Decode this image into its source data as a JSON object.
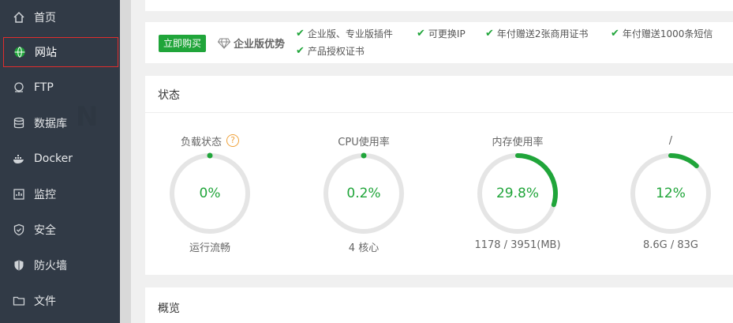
{
  "sidebar": {
    "items": [
      {
        "label": "首页",
        "icon": "home-icon"
      },
      {
        "label": "网站",
        "icon": "globe-icon",
        "active": true
      },
      {
        "label": "FTP",
        "icon": "ftp-icon"
      },
      {
        "label": "数据库",
        "icon": "database-icon"
      },
      {
        "label": "Docker",
        "icon": "docker-icon"
      },
      {
        "label": "监控",
        "icon": "monitor-icon"
      },
      {
        "label": "安全",
        "icon": "shield-icon"
      },
      {
        "label": "防火墙",
        "icon": "firewall-icon"
      },
      {
        "label": "文件",
        "icon": "folder-icon"
      }
    ]
  },
  "promo": {
    "buy_label": "立即购买",
    "enterprise_label": "企业版优势",
    "features": [
      "企业版、专业版插件",
      "可更换IP",
      "年付赠送2张商用证书",
      "年付赠送1000条短信",
      "产品授权证书"
    ]
  },
  "status": {
    "title": "状态",
    "gauges": [
      {
        "label": "负载状态",
        "value": "0%",
        "sub": "运行流畅",
        "percent": 0,
        "help": "?"
      },
      {
        "label": "CPU使用率",
        "value": "0.2%",
        "sub": "4 核心",
        "percent": 0.2
      },
      {
        "label": "内存使用率",
        "value": "29.8%",
        "sub": "1178 / 3951(MB)",
        "percent": 29.8
      },
      {
        "label": "/",
        "value": "12%",
        "sub": "8.6G / 83G",
        "percent": 12
      }
    ]
  },
  "overview": {
    "title": "概览"
  },
  "colors": {
    "accent": "#20a53a",
    "sidebar_bg": "#313a46",
    "track": "#e5e5e5",
    "active_border": "#e02d2d"
  }
}
